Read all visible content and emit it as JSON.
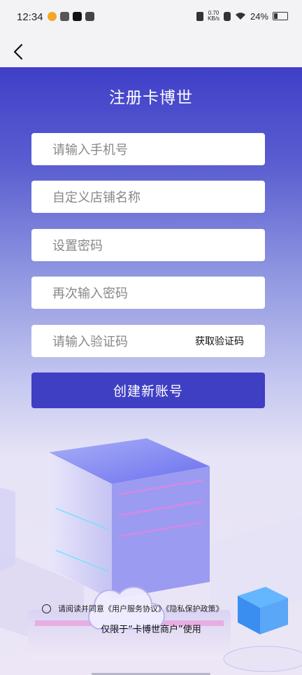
{
  "status_bar": {
    "time": "12:34",
    "net_speed_value": "0.70",
    "net_speed_unit": "KB/s",
    "battery": "24%",
    "icons": [
      "weibo-icon",
      "app-icon",
      "tiktok-icon",
      "mail-icon",
      "vibrate-icon",
      "sim-icon",
      "wifi-icon",
      "battery-icon"
    ]
  },
  "nav": {
    "back_icon": "chevron-left-icon"
  },
  "form": {
    "title": "注册卡博世",
    "phone_placeholder": "请输入手机号",
    "store_name_placeholder": "自定义店铺名称",
    "password_placeholder": "设置密码",
    "password_confirm_placeholder": "再次输入密码",
    "code_placeholder": "请输入验证码",
    "get_code_label": "获取验证码",
    "submit_label": "创建新账号"
  },
  "agreement": {
    "text": "请阅读并同意《用户服务协议》《隐私保护政策》",
    "checked": false
  },
  "note": "仅限于“卡博世商户”使用",
  "colors": {
    "primary": "#3f3fc4",
    "gradient_top": "#3f3fc8"
  }
}
